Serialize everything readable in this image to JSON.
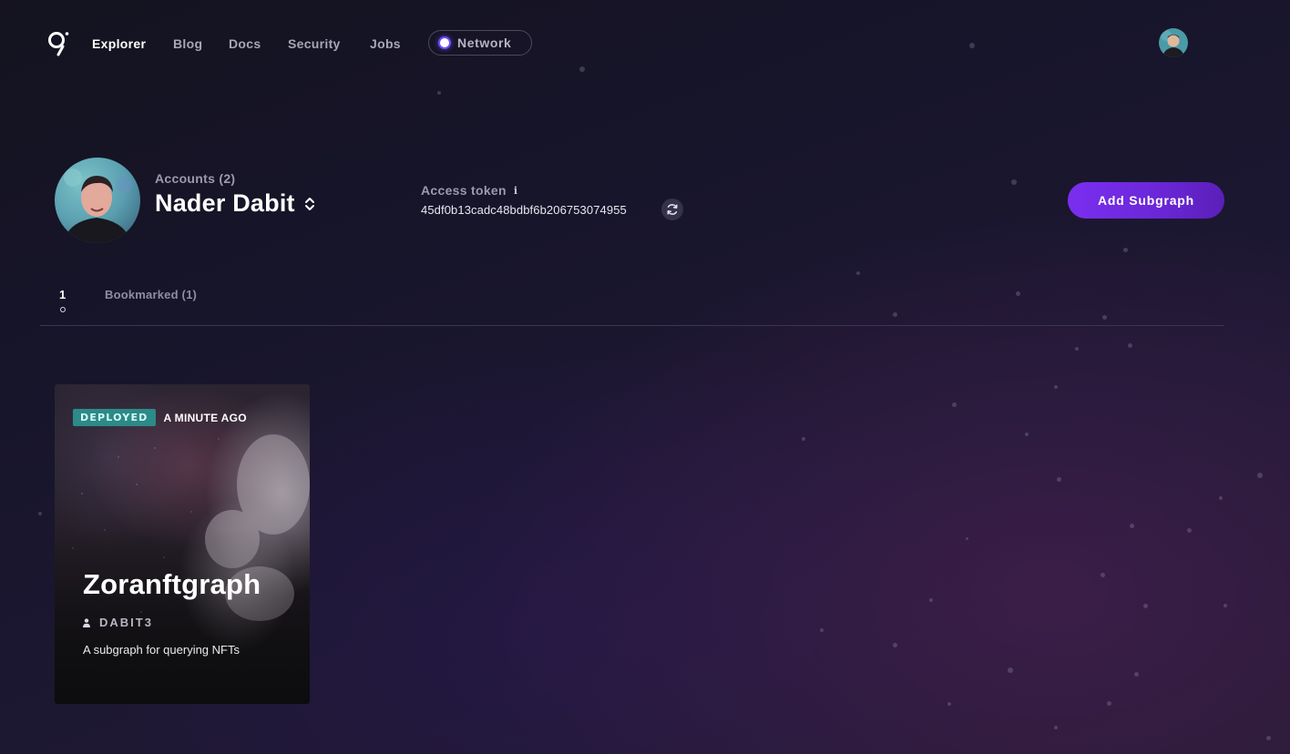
{
  "nav": {
    "items": [
      {
        "label": "Explorer",
        "active": true
      },
      {
        "label": "Blog",
        "active": false
      },
      {
        "label": "Docs",
        "active": false
      },
      {
        "label": "Security",
        "active": false
      },
      {
        "label": "Jobs",
        "active": false
      }
    ],
    "network_label": "Network"
  },
  "profile": {
    "accounts_label": "Accounts (2)",
    "name": "Nader Dabit",
    "access_token_label": "Access token",
    "access_token_info": "i",
    "access_token": "45df0b13cadc48bdbf6b206753074955"
  },
  "actions": {
    "add_subgraph": "Add Subgraph"
  },
  "tabs": {
    "items": [
      {
        "label": "1",
        "active": true
      },
      {
        "label": "Bookmarked (1)",
        "active": false
      }
    ]
  },
  "subgraphs": [
    {
      "status": "DEPLOYED",
      "time": "A MINUTE AGO",
      "name": "Zoranftgraph",
      "owner": "DABIT3",
      "description": "A subgraph for querying NFTs"
    }
  ],
  "colors": {
    "accent": "#7a2ff0",
    "deployed_badge": "#2c8a88"
  }
}
